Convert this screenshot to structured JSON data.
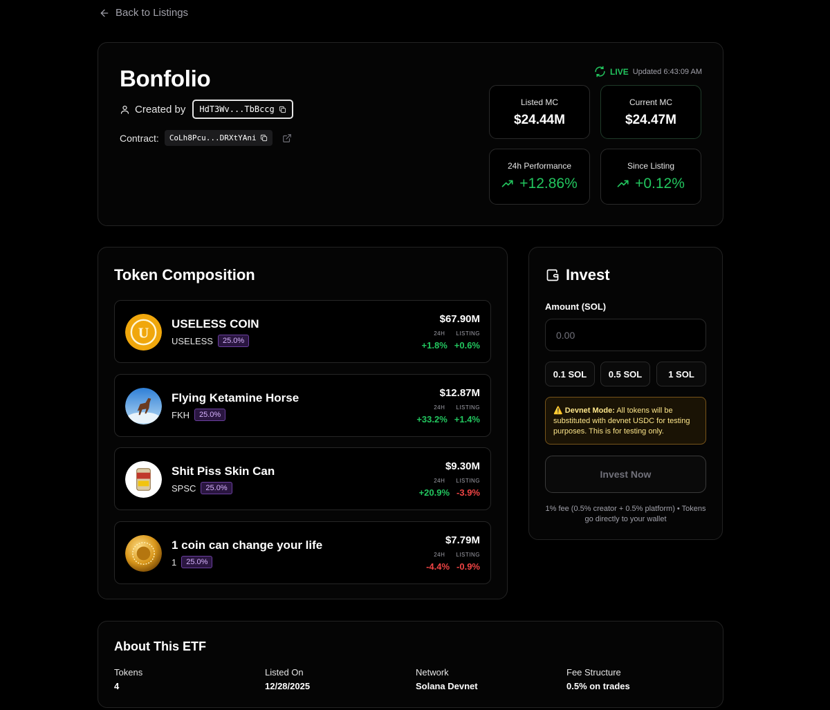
{
  "nav": {
    "back_label": "Back to Listings"
  },
  "etf": {
    "name": "Bonfolio",
    "created_by_label": "Created by",
    "creator_address": "HdT3Wv...TbBccg",
    "contract_label": "Contract:",
    "contract_address": "CoLh8Pcu...DRXtYAni",
    "live_label": "LIVE",
    "updated_text": "Updated 6:43:09 AM"
  },
  "stats": {
    "listed_mc": {
      "label": "Listed MC",
      "value": "$24.44M"
    },
    "current_mc": {
      "label": "Current MC",
      "value": "$24.47M"
    },
    "perf_24h": {
      "label": "24h Performance",
      "value": "+12.86%"
    },
    "since_listing": {
      "label": "Since Listing",
      "value": "+0.12%"
    }
  },
  "composition": {
    "title": "Token Composition",
    "col_24h": "24H",
    "col_listing": "LISTING",
    "tokens": [
      {
        "name": "USELESS COIN",
        "symbol": "USELESS",
        "weight": "25.0%",
        "price": "$67.90M",
        "change_24h": "+1.8%",
        "change_listing": "+0.6%"
      },
      {
        "name": "Flying Ketamine Horse",
        "symbol": "FKH",
        "weight": "25.0%",
        "price": "$12.87M",
        "change_24h": "+33.2%",
        "change_listing": "+1.4%"
      },
      {
        "name": "Shit Piss Skin Can",
        "symbol": "SPSC",
        "weight": "25.0%",
        "price": "$9.30M",
        "change_24h": "+20.9%",
        "change_listing": "-3.9%"
      },
      {
        "name": "1 coin can change your life",
        "symbol": "1",
        "weight": "25.0%",
        "price": "$7.79M",
        "change_24h": "-4.4%",
        "change_listing": "-0.9%"
      }
    ]
  },
  "invest": {
    "title": "Invest",
    "amount_label": "Amount (SOL)",
    "amount_placeholder": "0.00",
    "quick_1": "0.1 SOL",
    "quick_2": "0.5 SOL",
    "quick_3": "1 SOL",
    "devnet_title": "Devnet Mode:",
    "devnet_text": "All tokens will be substituted with devnet USDC for testing purposes. This is for testing only.",
    "button_label": "Invest Now",
    "fee_note": "1% fee (0.5% creator + 0.5% platform) • Tokens go directly to your wallet"
  },
  "about": {
    "title": "About This ETF",
    "tokens_label": "Tokens",
    "tokens_value": "4",
    "listed_label": "Listed On",
    "listed_value": "12/28/2025",
    "network_label": "Network",
    "network_value": "Solana Devnet",
    "fee_label": "Fee Structure",
    "fee_value": "0.5% on trades"
  },
  "colors": {
    "positive": "#22c55e",
    "negative": "#ef4444",
    "badge": "#6b3fa0",
    "warning": "#fde68a"
  }
}
